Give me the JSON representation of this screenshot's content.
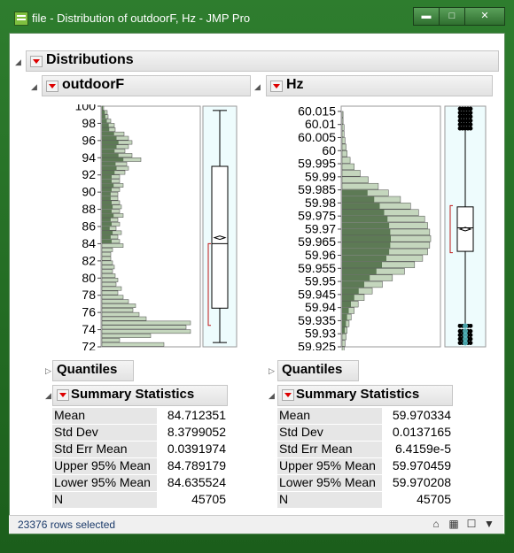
{
  "window": {
    "title": "file - Distribution of outdoorF, Hz - JMP Pro",
    "controls": [
      "minimize",
      "maximize",
      "close"
    ]
  },
  "report": {
    "title": "Distributions"
  },
  "panels": [
    {
      "variable": "outdoorF",
      "y_ticks": [
        "100",
        "98",
        "96",
        "94",
        "92",
        "90",
        "88",
        "86",
        "84",
        "82",
        "80",
        "78",
        "76",
        "74",
        "72"
      ],
      "quantiles_label": "Quantiles",
      "summary_label": "Summary Statistics",
      "stats": [
        {
          "label": "Mean",
          "value": "84.712351"
        },
        {
          "label": "Std Dev",
          "value": "8.3799052"
        },
        {
          "label": "Std Err Mean",
          "value": "0.0391974"
        },
        {
          "label": "Upper 95% Mean",
          "value": "84.789179"
        },
        {
          "label": "Lower 95% Mean",
          "value": "84.635524"
        },
        {
          "label": "N",
          "value": "45705"
        }
      ]
    },
    {
      "variable": "Hz",
      "y_ticks": [
        "60.015",
        "60.01",
        "60.005",
        "60",
        "59.995",
        "59.99",
        "59.985",
        "59.98",
        "59.975",
        "59.97",
        "59.965",
        "59.96",
        "59.955",
        "59.95",
        "59.945",
        "59.94",
        "59.935",
        "59.93",
        "59.925"
      ],
      "quantiles_label": "Quantiles",
      "summary_label": "Summary Statistics",
      "stats": [
        {
          "label": "Mean",
          "value": "59.970334"
        },
        {
          "label": "Std Dev",
          "value": "0.0137165"
        },
        {
          "label": "Std Err Mean",
          "value": "6.4159e-5"
        },
        {
          "label": "Upper 95% Mean",
          "value": "59.970459"
        },
        {
          "label": "Lower 95% Mean",
          "value": "59.970208"
        },
        {
          "label": "N",
          "value": "45705"
        }
      ]
    }
  ],
  "status": {
    "rows_selected": "23376 rows selected"
  },
  "colors": {
    "bar_fill": "#c4d6bd",
    "bar_selected": "#5d7a55",
    "box_bg": "#eefcfd",
    "outlier_fill": "#5ac8d0"
  },
  "chart_data": [
    {
      "type": "bar",
      "orientation": "horizontal",
      "variable": "outdoorF",
      "ylim": [
        72,
        100
      ],
      "bin_width": 0.5,
      "bins": [
        72.5,
        73,
        73.5,
        74,
        74.5,
        75,
        75.5,
        76,
        76.5,
        77,
        77.5,
        78,
        78.5,
        79,
        79.5,
        80,
        80.5,
        81,
        81.5,
        82,
        82.5,
        83,
        83.5,
        84,
        84.5,
        85,
        85.5,
        86,
        86.5,
        87,
        87.5,
        88,
        88.5,
        89,
        89.5,
        90,
        90.5,
        91,
        91.5,
        92,
        92.5,
        93,
        93.5,
        94,
        94.5,
        95,
        95.5,
        96,
        96.5,
        97,
        97.5,
        98,
        98.5,
        99,
        99.5,
        100
      ],
      "counts": [
        70,
        20,
        55,
        100,
        95,
        100,
        50,
        42,
        35,
        38,
        30,
        24,
        18,
        22,
        16,
        18,
        15,
        12,
        14,
        12,
        10,
        10,
        12,
        24,
        20,
        18,
        22,
        16,
        20,
        18,
        24,
        20,
        22,
        20,
        18,
        18,
        20,
        24,
        20,
        20,
        26,
        30,
        28,
        44,
        34,
        26,
        30,
        34,
        30,
        25,
        15,
        14,
        10,
        7,
        6,
        2
      ],
      "selected_from": 84,
      "box": {
        "q1": 76.5,
        "median": 84,
        "q3": 93,
        "whisker_low": 72.5,
        "whisker_high": 99.5,
        "mean": 84.7
      },
      "shortest_half": [
        74.5,
        84
      ]
    },
    {
      "type": "bar",
      "orientation": "horizontal",
      "variable": "Hz",
      "ylim": [
        59.925,
        60.017
      ],
      "bin_width": 0.0025,
      "bins": [
        59.925,
        59.9275,
        59.93,
        59.9325,
        59.935,
        59.9375,
        59.94,
        59.9425,
        59.945,
        59.9475,
        59.95,
        59.9525,
        59.955,
        59.9575,
        59.96,
        59.9625,
        59.965,
        59.9675,
        59.97,
        59.9725,
        59.975,
        59.9775,
        59.98,
        59.9825,
        59.985,
        59.9875,
        59.99,
        59.9925,
        59.995,
        59.9975,
        60,
        60.0025,
        60.005,
        60.0075,
        60.01,
        60.0125,
        60.015
      ],
      "counts": [
        2,
        3,
        4,
        5,
        7,
        9,
        12,
        16,
        22,
        30,
        40,
        50,
        62,
        72,
        80,
        85,
        87,
        88,
        87,
        85,
        82,
        76,
        68,
        58,
        46,
        36,
        26,
        18,
        12,
        8,
        5,
        4,
        3,
        2,
        2,
        1,
        1
      ],
      "selected_from": 59.93,
      "selected_to": 59.985,
      "box": {
        "q1": 59.9615,
        "median": 59.9705,
        "q3": 59.9785,
        "whisker_low": 59.9335,
        "whisker_high": 60.0085,
        "mean": 59.97
      },
      "shortest_half": [
        59.961,
        59.979
      ],
      "outliers_high": [
        60.0085,
        60.01,
        60.0115,
        60.013,
        60.0145,
        60.016
      ],
      "outliers_low": [
        59.9265,
        59.928,
        59.9295,
        59.931,
        59.933
      ]
    }
  ]
}
